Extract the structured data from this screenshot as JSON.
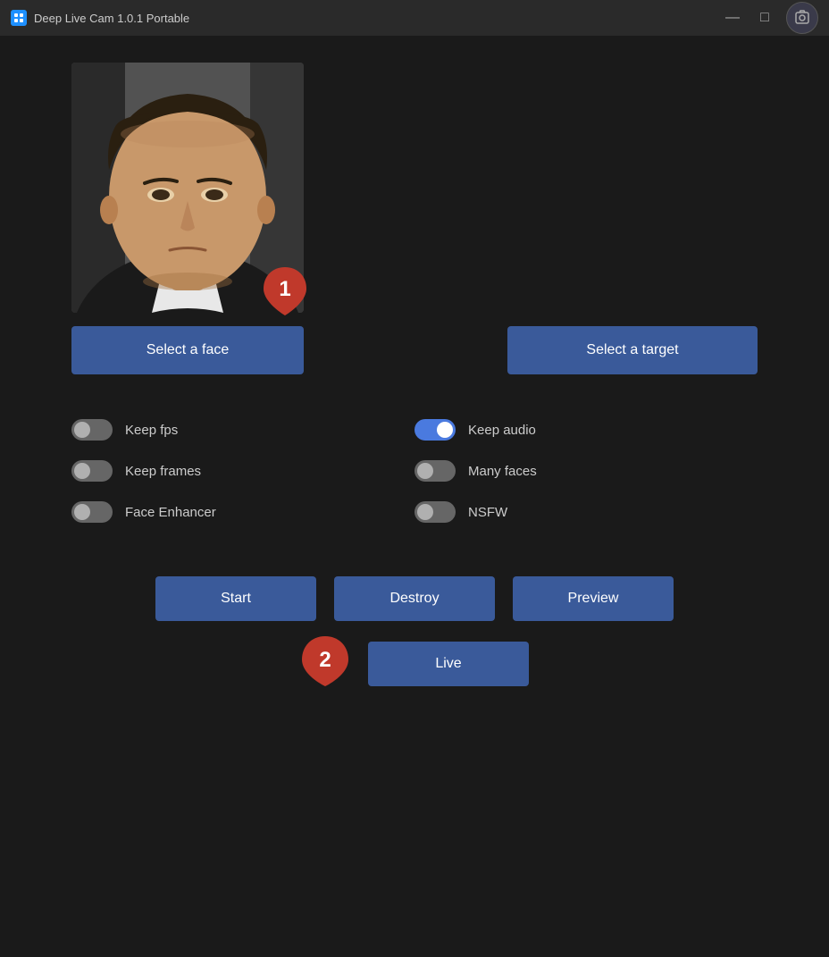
{
  "titleBar": {
    "title": "Deep Live Cam 1.0.1 Portable",
    "minimizeBtn": "—",
    "maximizeBtn": "□",
    "screenshotIcon": "⊡"
  },
  "faceSection": {
    "badgeNumber": "1",
    "selectFaceBtn": "Select a face"
  },
  "targetSection": {
    "selectTargetBtn": "Select a target"
  },
  "toggles": {
    "left": [
      {
        "id": "keep-fps",
        "label": "Keep fps",
        "state": "off"
      },
      {
        "id": "keep-frames",
        "label": "Keep frames",
        "state": "off"
      },
      {
        "id": "face-enhancer",
        "label": "Face Enhancer",
        "state": "off"
      }
    ],
    "right": [
      {
        "id": "keep-audio",
        "label": "Keep audio",
        "state": "on"
      },
      {
        "id": "many-faces",
        "label": "Many faces",
        "state": "off"
      },
      {
        "id": "nsfw",
        "label": "NSFW",
        "state": "off"
      }
    ]
  },
  "actionButtons": {
    "start": "Start",
    "destroy": "Destroy",
    "preview": "Preview",
    "live": "Live",
    "liveBadge": "2"
  }
}
